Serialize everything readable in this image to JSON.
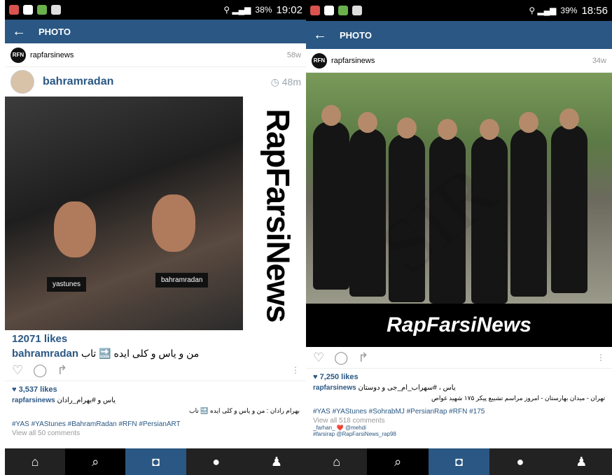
{
  "left": {
    "status": {
      "battery": "38%",
      "time": "19:02"
    },
    "appbar": {
      "back": "←",
      "title": "PHOTO"
    },
    "feed": {
      "logo": "RFN",
      "account": "rapfarsinews",
      "ago": "58w"
    },
    "post": {
      "user": "bahramradan",
      "time": "48m"
    },
    "photo": {
      "tag1": "yastunes",
      "tag2": "bahramradan",
      "watermark": "RapFarsiNews"
    },
    "overlay": {
      "likes": "12071 likes",
      "user": "bahramradan",
      "caption": "من و یاس و کلی ایده 🔜 تاب"
    },
    "likes": "♥ 3,537 likes",
    "caption_user": "rapfarsinews",
    "caption_text": "یاس و #بهرام_رادان",
    "caption_line": "بهرام رادان : من و یاس و کلی ایده 🔜 تاب",
    "hashtags": "#YAS #YAStunes #BahramRadan #RFN #PersianART",
    "view_all": "View all 50 comments"
  },
  "right": {
    "status": {
      "battery": "39%",
      "time": "18:56"
    },
    "appbar": {
      "back": "←",
      "title": "PHOTO"
    },
    "feed": {
      "logo": "RFN",
      "account": "rapfarsinews",
      "ago": "34w"
    },
    "brand": "RapFarsiNews",
    "likes": "♥ 7,250 likes",
    "caption_user": "rapfarsinews",
    "caption_text": "یاس ، #سهراب_ام_جی و دوستان",
    "caption_line": "تهران - میدان بهارستان - امروز مراسم تشییع پیکر ۱۷۵ شهید غواص",
    "hashtags": "#YAS #YAStunes #SohrabMJ #PersianRap #RFN #175",
    "view_all": "View all 518 comments",
    "comment1": "_farhan_ ❤️ @mehdi",
    "comment2": "#farsirap @RapFarsiNews_rap98"
  },
  "watermark": "SIR",
  "colors": {
    "appbar": "#2a5783",
    "accent": "#2a5783"
  },
  "nav_icons": [
    "home-icon",
    "search-icon",
    "camera-icon",
    "activity-icon",
    "profile-icon"
  ]
}
